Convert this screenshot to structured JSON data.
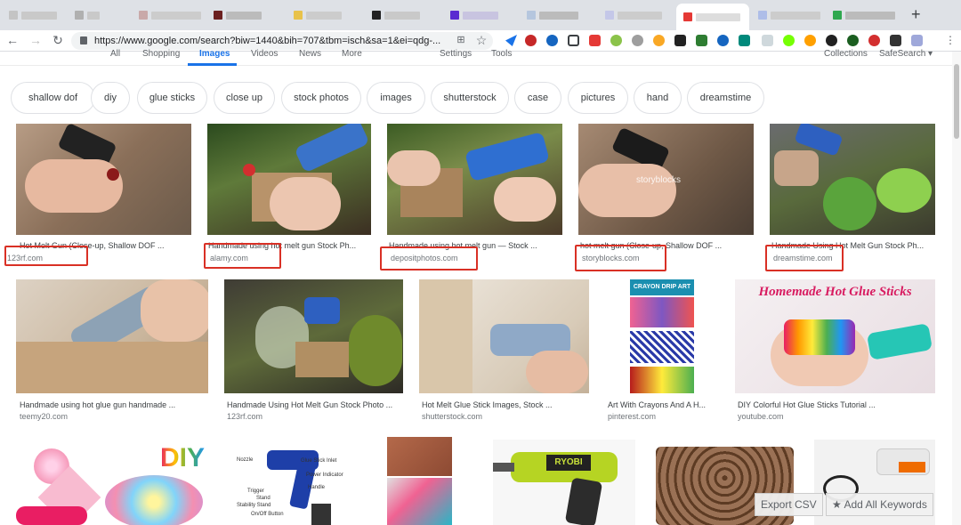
{
  "browser": {
    "url": "https://www.google.com/search?biw=1440&bih=707&tbm=isch&sa=1&ei=qdg-...",
    "new_tab": "+"
  },
  "google": {
    "tabs": [
      {
        "label": "All"
      },
      {
        "label": "Shopping"
      },
      {
        "label": "Images"
      },
      {
        "label": "Videos"
      },
      {
        "label": "News"
      },
      {
        "label": "More"
      }
    ],
    "settings": "Settings",
    "tools": "Tools",
    "collections": "Collections",
    "safesearch": "SafeSearch ▾"
  },
  "chips": [
    "shallow dof",
    "diy",
    "glue sticks",
    "close up",
    "stock photos",
    "images",
    "shutterstock",
    "case",
    "pictures",
    "hand",
    "dreamstime"
  ],
  "row1": [
    {
      "title": "Hot Melt Gun (Close-up, Shallow DOF ...",
      "source": "123rf.com"
    },
    {
      "title": "Handmade using hot melt gun Stock Ph...",
      "source": "alamy.com"
    },
    {
      "title": "Handmade using hot melt gun — Stock ...",
      "source": "depositphotos.com"
    },
    {
      "title": "hot melt gun (Close-up, Shallow DOF ...",
      "source": "storyblocks.com"
    },
    {
      "title": "Handmade Using Hot Melt Gun Stock Ph...",
      "source": "dreamstime.com"
    }
  ],
  "row2": [
    {
      "title": "Handmade using hot glue gun handmade ...",
      "source": "teemy20.com"
    },
    {
      "title": "Handmade Using Hot Melt Gun Stock Photo ...",
      "source": "123rf.com"
    },
    {
      "title": "Hot Melt Glue Stick Images, Stock ...",
      "source": "shutterstock.com"
    },
    {
      "title": "Art With Crayons And A H...",
      "source": "pinterest.com"
    },
    {
      "title": "DIY Colorful Hot Glue Sticks Tutorial ...",
      "source": "youtube.com"
    }
  ],
  "thumb_text": {
    "storyblocks_watermark": "storyblocks",
    "crayon_art": "CRAYON DRIP ART",
    "homemade": "Homemade Hot Glue Sticks",
    "diy": "DIY",
    "ryobi": "RYOBI",
    "diagram_labels": [
      "Nozzle",
      "Glue Stick Inlet",
      "Power Indicator",
      "Handle",
      "Trigger",
      "Stand",
      "Stability Stand",
      "On/Off Button"
    ]
  },
  "overlay": {
    "export_csv": "Export CSV",
    "add_keywords": "Add All Keywords"
  },
  "colors": {
    "accent": "#1a73e8",
    "highlight": "#d93025",
    "chip_border": "#dfe1e5"
  }
}
